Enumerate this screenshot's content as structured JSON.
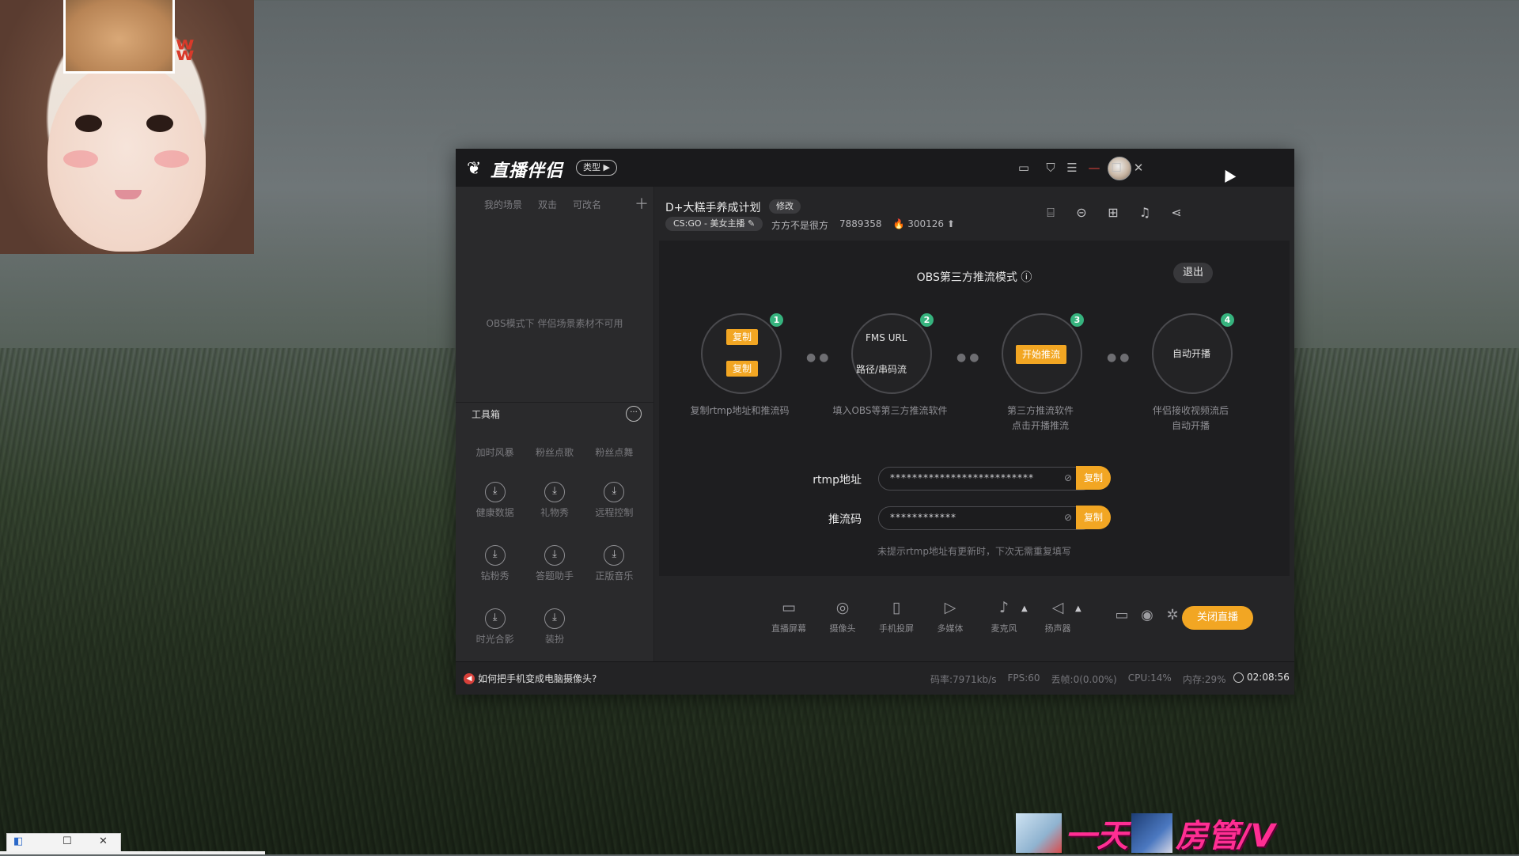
{
  "app": {
    "logo_text": "直播伴侣",
    "type_label": "类型 ▶"
  },
  "window_controls": [
    "screen-icon",
    "shirt-icon",
    "menu-icon",
    "minimize-icon",
    "maximize-icon",
    "close-icon"
  ],
  "left_panel": {
    "scene_tabs": [
      "我的场景",
      "双击",
      "可改名"
    ],
    "empty_text": "OBS模式下 伴侣场景素材不可用",
    "toolbox_title": "工具箱",
    "partial_tools": [
      "加时风暴",
      "粉丝点歌",
      "粉丝点舞"
    ],
    "tools": [
      "健康数据",
      "礼物秀",
      "远程控制",
      "钻粉秀",
      "答题助手",
      "正版音乐",
      "时光合影",
      "装扮"
    ]
  },
  "header": {
    "stream_title": "D+大糕手养成计划",
    "edit_label": "修改",
    "game_category": "CS:GO - 美女主播 ✎",
    "streamer_name": "方方不是很方",
    "room_id": "7889358",
    "heat": "🔥 300126 ⬆"
  },
  "obs": {
    "title": "OBS第三方推流模式 ⓘ",
    "exit_label": "退出",
    "steps": [
      {
        "num": "1",
        "btn1": "复制",
        "btn2": "复制",
        "caption": "复制rtmp地址和推流码"
      },
      {
        "num": "2",
        "line1": "FMS URL",
        "line2": "路径/串码流",
        "caption": "填入OBS等第三方推流软件"
      },
      {
        "num": "3",
        "btn": "开始推流",
        "caption": "第三方推流软件\n点击开播推流"
      },
      {
        "num": "4",
        "text": "自动开播",
        "caption": "伴侣接收视频流后\n自动开播"
      }
    ],
    "rtmp_label": "rtmp地址",
    "rtmp_value": "**************************",
    "key_label": "推流码",
    "key_value": "************",
    "copy_label": "复制",
    "hint": "未提示rtmp地址有更新时，下次无需重复填写"
  },
  "bottom_tools": [
    "直播屏幕",
    "摄像头",
    "手机投屏",
    "多媒体",
    "麦克风",
    "扬声器"
  ],
  "close_live_label": "关闭直播",
  "status": {
    "tip": "如何把手机变成电脑摄像头?",
    "bitrate": "码率:7971kb/s",
    "fps": "FPS:60",
    "dropped": "丢帧:0(0.00%)",
    "cpu": "CPU:14%",
    "memory": "内存:29%",
    "timer": "02:08:56"
  },
  "danmaku": {
    "text1": "一天",
    "text2": "房管/V"
  },
  "colors": {
    "accent": "#f2a623",
    "badge": "#36b37e",
    "danmaku": "#ff2e93"
  }
}
